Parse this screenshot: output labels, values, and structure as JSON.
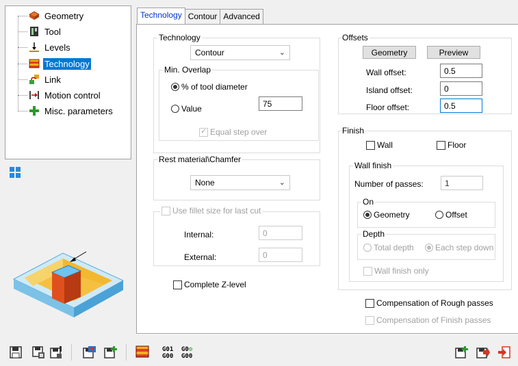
{
  "tree": {
    "items": [
      {
        "label": "Geometry",
        "icon": "geometry-icon"
      },
      {
        "label": "Tool",
        "icon": "tool-icon"
      },
      {
        "label": "Levels",
        "icon": "levels-icon"
      },
      {
        "label": "Technology",
        "icon": "technology-icon"
      },
      {
        "label": "Link",
        "icon": "link-icon"
      },
      {
        "label": "Motion control",
        "icon": "motion-control-icon"
      },
      {
        "label": "Misc. parameters",
        "icon": "misc-parameters-icon"
      }
    ],
    "selected": "Technology"
  },
  "tabs": [
    "Technology",
    "Contour",
    "Advanced"
  ],
  "technology": {
    "title": "Technology",
    "combo_value": "Contour",
    "min_overlap": {
      "title": "Min. Overlap",
      "opt_percent": "% of tool diameter",
      "opt_value": "Value",
      "value": "75",
      "equal_step": "Equal step over"
    }
  },
  "rest": {
    "title": "Rest material\\Chamfer",
    "combo_value": "None"
  },
  "fillet": {
    "title": "Use fillet size for last cut",
    "internal_label": "Internal:",
    "internal_value": "0",
    "external_label": "External:",
    "external_value": "0"
  },
  "complete_z": "Complete Z-level",
  "offsets": {
    "title": "Offsets",
    "geometry_btn": "Geometry",
    "preview_btn": "Preview",
    "wall_label": "Wall offset:",
    "wall_value": "0.5",
    "island_label": "Island offset:",
    "island_value": "0",
    "floor_label": "Floor offset:",
    "floor_value": "0.5"
  },
  "finish": {
    "title": "Finish",
    "wall": "Wall",
    "floor": "Floor",
    "wall_finish": {
      "title": "Wall finish",
      "passes_label": "Number of passes:",
      "passes_value": "1",
      "on_title": "On",
      "on_geometry": "Geometry",
      "on_offset": "Offset",
      "depth_title": "Depth",
      "depth_total": "Total depth",
      "depth_each": "Each step down",
      "wall_finish_only": "Wall finish only"
    }
  },
  "comp_rough": "Compensation of Rough  passes",
  "comp_finish": "Compensation of Finish passes",
  "toolbar": {
    "g01": "G01",
    "g00a": "G00",
    "g0": "G0",
    "g00b": "G00"
  }
}
